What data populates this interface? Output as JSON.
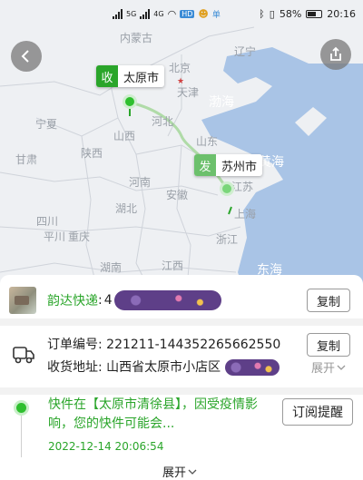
{
  "status_bar": {
    "network_1": "5G",
    "network_2": "4G",
    "hd_badge": "HD",
    "app_badge": "单",
    "battery_percent": "58%",
    "time": "20:16"
  },
  "map": {
    "labels": {
      "inner_mongolia": "内蒙古",
      "beijing": "北京",
      "tianjin": "天津",
      "liaoning": "辽宁",
      "ningxia": "宁夏",
      "hebei": "河北",
      "bohai": "渤海",
      "shanxi": "山西",
      "shandong": "山东",
      "shaanxi": "陕西",
      "gansu": "甘肃",
      "henan": "河南",
      "jiangsu": "江苏",
      "yellow_sea": "黄海",
      "anhui": "安徽",
      "sichuan": "四川",
      "hubei": "湖北",
      "shanghai": "上海",
      "chongqing": "重庆",
      "zhejiang": "浙江",
      "pingchuan": "平川",
      "hunan": "湖南",
      "jiangxi": "江西",
      "east_sea": "东海"
    },
    "origin_tag_type": "收",
    "origin_city": "太原市",
    "dest_tag_type": "发",
    "dest_city": "苏州市"
  },
  "courier": {
    "name": "韵达快递",
    "colon": ":",
    "number_prefix": "4",
    "copy_label": "复制"
  },
  "order": {
    "number_label": "订单编号:",
    "number_value": "221211-144352265662550",
    "copy_label": "复制",
    "address_label": "收货地址:",
    "address_value": "山西省太原市小店区",
    "expand_label": "展开"
  },
  "tracking": {
    "text": "快件在【太原市清徐县】，因受疫情影响，您的快件可能会...",
    "time": "2022-12-14 20:06:54",
    "subscribe_label": "订阅提醒",
    "expand_label": "展开"
  },
  "colors": {
    "accent_green": "#2aa52a",
    "map_land": "#eef0f3",
    "map_sea": "#a9c4e6",
    "route": "#a9d8a0"
  }
}
